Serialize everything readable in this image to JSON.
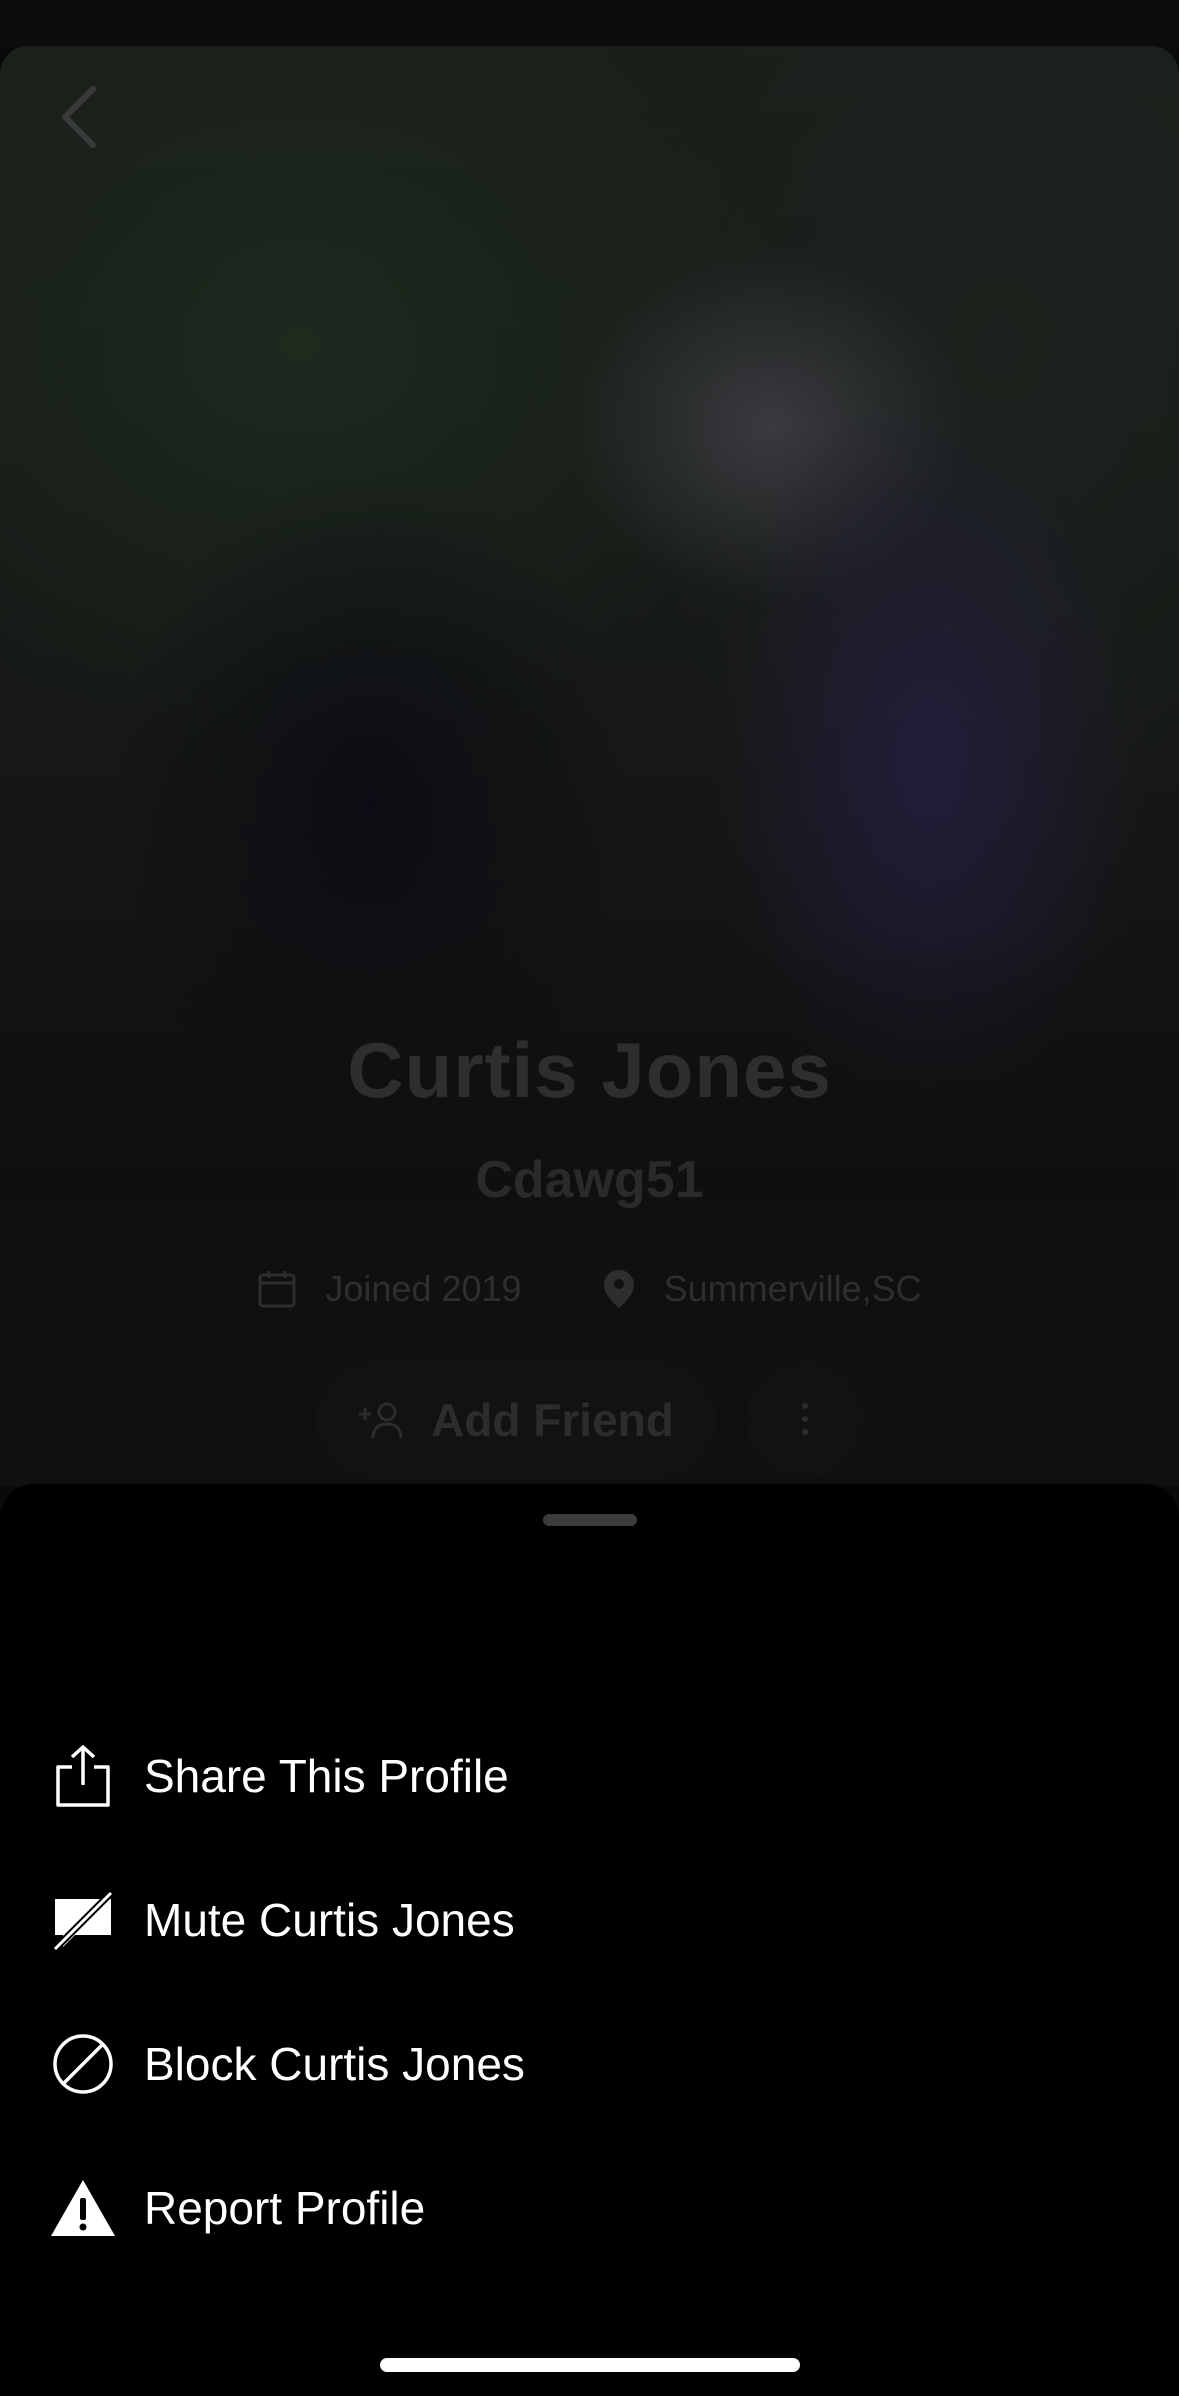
{
  "profile": {
    "name": "Curtis Jones",
    "username": "Cdawg51",
    "joined": "Joined 2019",
    "location": "Summerville,SC"
  },
  "actions": {
    "add_friend_label": "Add Friend"
  },
  "sheet": {
    "items": [
      {
        "label": "Share This Profile",
        "icon": "share-icon"
      },
      {
        "label": "Mute Curtis Jones",
        "icon": "mute-icon"
      },
      {
        "label": "Block Curtis Jones",
        "icon": "block-icon"
      },
      {
        "label": "Report Profile",
        "icon": "warning-icon"
      }
    ]
  }
}
